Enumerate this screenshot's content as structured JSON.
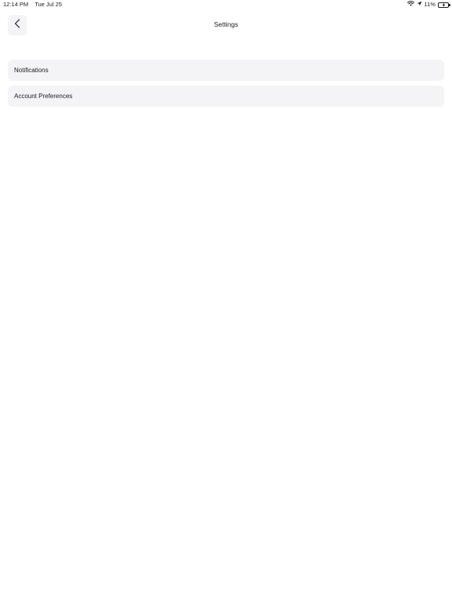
{
  "status_bar": {
    "time": "12:14 PM",
    "date": "Tue Jul 25",
    "battery_percent": "11%",
    "icons": [
      "wifi-icon",
      "location-arrow-icon",
      "battery-charging-icon"
    ]
  },
  "nav": {
    "title": "Settings",
    "back_icon": "chevron-left-icon"
  },
  "settings_items": [
    {
      "label": "Notifications"
    },
    {
      "label": "Account Preferences"
    }
  ],
  "colors": {
    "row_background": "#f4f3f6",
    "text": "#1c1c1e",
    "background": "#ffffff"
  }
}
